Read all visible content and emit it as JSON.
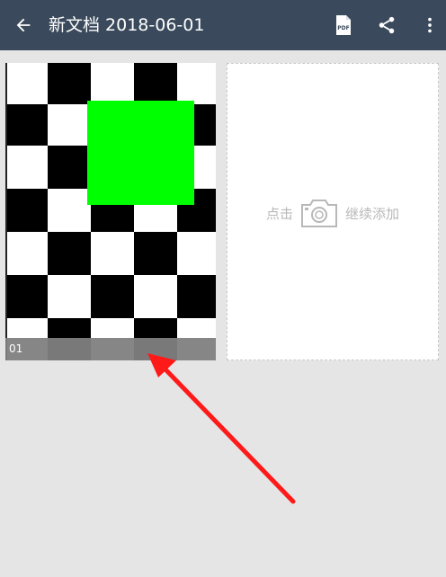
{
  "toolbar": {
    "title": "新文档 2018-06-01",
    "pdf_icon_text": "PDF",
    "icons": [
      "back-arrow-icon",
      "pdf-icon",
      "share-icon",
      "more-vert-icon"
    ]
  },
  "pages": [
    {
      "label": "01"
    }
  ],
  "add_card": {
    "left_text": "点击",
    "right_text": "继续添加",
    "icon": "camera-icon"
  },
  "colors": {
    "toolbar": "#3a4a5c",
    "background": "#e5e5e5",
    "accent_green": "#00ff00",
    "arrow_red": "#ff1a1a"
  }
}
